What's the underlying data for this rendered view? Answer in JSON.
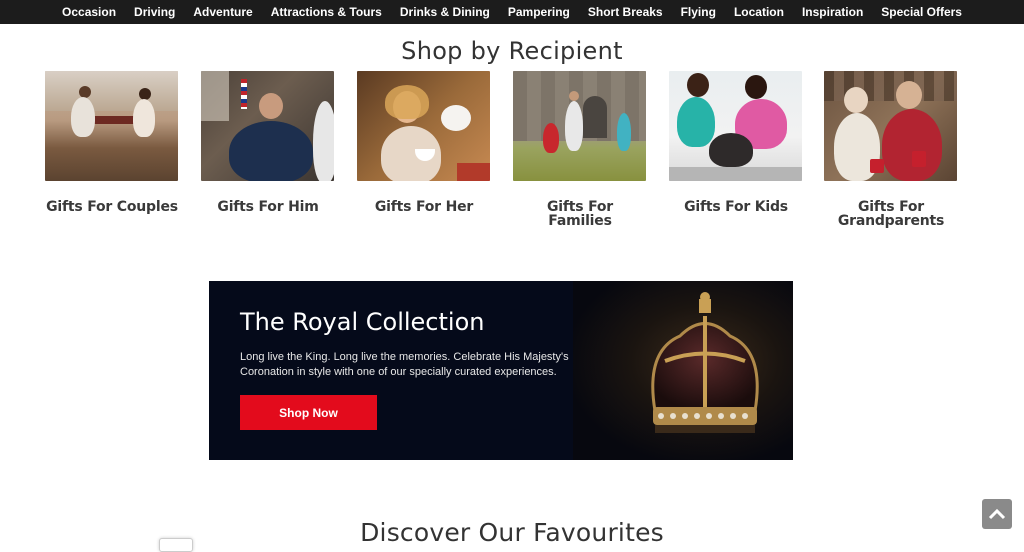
{
  "nav": {
    "items": [
      "Occasion",
      "Driving",
      "Adventure",
      "Attractions & Tours",
      "Drinks & Dining",
      "Pampering",
      "Short Breaks",
      "Flying",
      "Location",
      "Inspiration",
      "Special Offers"
    ]
  },
  "recipients_section": {
    "title": "Shop by Recipient",
    "items": [
      {
        "label": "Gifts For Couples"
      },
      {
        "label": "Gifts For Him"
      },
      {
        "label": "Gifts For Her"
      },
      {
        "label": "Gifts For Families"
      },
      {
        "label": "Gifts For Kids"
      },
      {
        "label": "Gifts For Grandparents"
      }
    ]
  },
  "banner": {
    "title": "The Royal Collection",
    "text": "Long live the King. Long live the memories. Celebrate His Majesty's Coronation in style with one of our specially curated experiences.",
    "button": "Shop Now"
  },
  "favourites": {
    "title": "Discover Our Favourites"
  },
  "colors": {
    "nav_bg": "#1c1c1c",
    "accent_red": "#e30b1c",
    "banner_bg": "#050a1a"
  },
  "icons": {
    "back_to_top": "chevron-up-icon"
  }
}
